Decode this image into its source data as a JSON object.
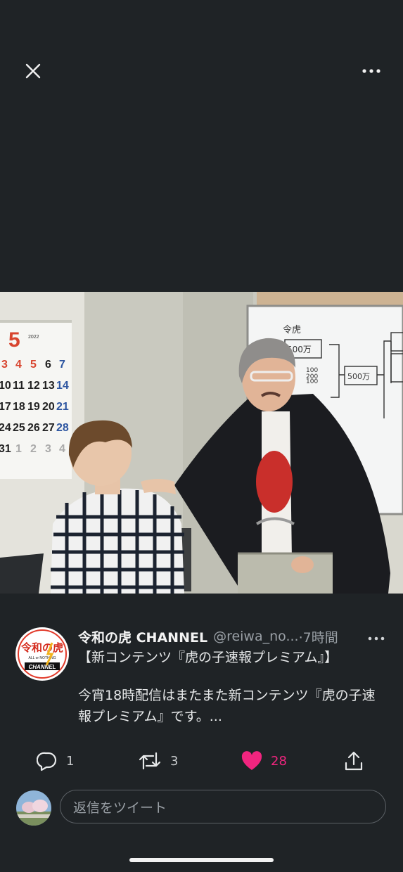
{
  "top_bar": {
    "close_icon": "close-icon",
    "more_icon": "more-horizontal-icon"
  },
  "media": {
    "description": "photo",
    "calendar": {
      "month": "5",
      "year": "2022",
      "rows": [
        [
          "3",
          "4",
          "5",
          "6",
          "7"
        ],
        [
          "10",
          "11",
          "12",
          "13",
          "14"
        ],
        [
          "17",
          "18",
          "19",
          "20",
          "21"
        ],
        [
          "24",
          "25",
          "26",
          "27",
          "28"
        ],
        [
          "31",
          "1",
          "2",
          "3",
          "4"
        ]
      ]
    },
    "whiteboard": {
      "title": "令虎",
      "box1": "500万",
      "box2": "500万",
      "lines": [
        "200",
        "100",
        "100"
      ]
    }
  },
  "tweet": {
    "display_name": "令和の虎 CHANNEL",
    "handle": "@reiwa_no...",
    "time": "·7時間",
    "title": "【新コンテンツ『虎の子速報プレミアム』】",
    "body": "今宵18時配信はまたまた新コンテンツ『虎の子速報プレミアム』です。...",
    "avatar_logo": {
      "main": "令和の虎",
      "sub": "ALL or NOTHING",
      "bottom": "CHANNEL"
    }
  },
  "actions": {
    "reply": {
      "icon": "reply-icon",
      "count": "1"
    },
    "retweet": {
      "icon": "retweet-icon",
      "count": "3"
    },
    "like": {
      "icon": "heart-icon",
      "count": "28",
      "color": "#f1257f"
    },
    "share": {
      "icon": "share-icon"
    }
  },
  "reply_bar": {
    "placeholder": "返信をツイート"
  }
}
